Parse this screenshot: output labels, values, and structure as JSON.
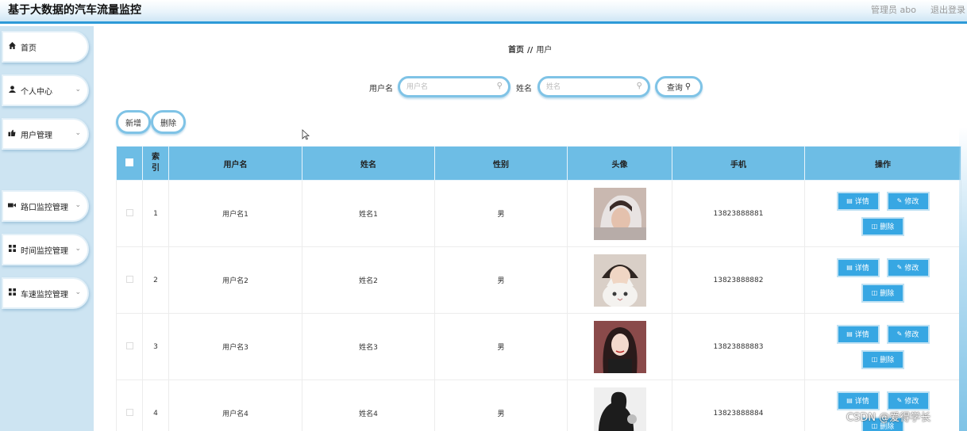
{
  "header": {
    "app_title": "基于大数据的汽车流量监控",
    "admin": "管理员 abo",
    "logout": "退出登录"
  },
  "sidebar": {
    "items": [
      {
        "label": "首页",
        "icon": "home-icon"
      },
      {
        "label": "个人中心",
        "icon": "user-icon"
      },
      {
        "label": "用户管理",
        "icon": "user-manage-icon"
      },
      {
        "label": "路口监控管理",
        "icon": "camera-icon"
      },
      {
        "label": "时间监控管理",
        "icon": "grid-icon"
      },
      {
        "label": "车速监控管理",
        "icon": "grid-icon"
      }
    ],
    "sub_item": "用户"
  },
  "breadcrumb": {
    "home": "首页",
    "separator": "//",
    "current": "用户"
  },
  "search": {
    "username_label": "用户名",
    "username_placeholder": "用户名",
    "name_label": "姓名",
    "name_placeholder": "姓名",
    "query_label": "查询"
  },
  "toolbar": {
    "add_label": "新增",
    "delete_label": "删除"
  },
  "table": {
    "headers": {
      "index": "索引",
      "username": "用户名",
      "name": "姓名",
      "gender": "性别",
      "avatar": "头像",
      "phone": "手机",
      "actions": "操作"
    },
    "rows": [
      {
        "index": "1",
        "username": "用户名1",
        "name": "姓名1",
        "gender": "男",
        "phone": "13823888881"
      },
      {
        "index": "2",
        "username": "用户名2",
        "name": "姓名2",
        "gender": "男",
        "phone": "13823888882"
      },
      {
        "index": "3",
        "username": "用户名3",
        "name": "姓名3",
        "gender": "男",
        "phone": "13823888883"
      },
      {
        "index": "4",
        "username": "用户名4",
        "name": "姓名4",
        "gender": "男",
        "phone": "13823888884"
      }
    ],
    "actions": {
      "detail": "详情",
      "edit": "修改",
      "delete": "删除"
    }
  },
  "watermark": "CSDN @爱得学长",
  "colors": {
    "accent": "#2d9ad8",
    "header_bg": "#6dbde5",
    "button_blue": "#37a7e3",
    "sidebar_bg": "#cde4f2"
  }
}
